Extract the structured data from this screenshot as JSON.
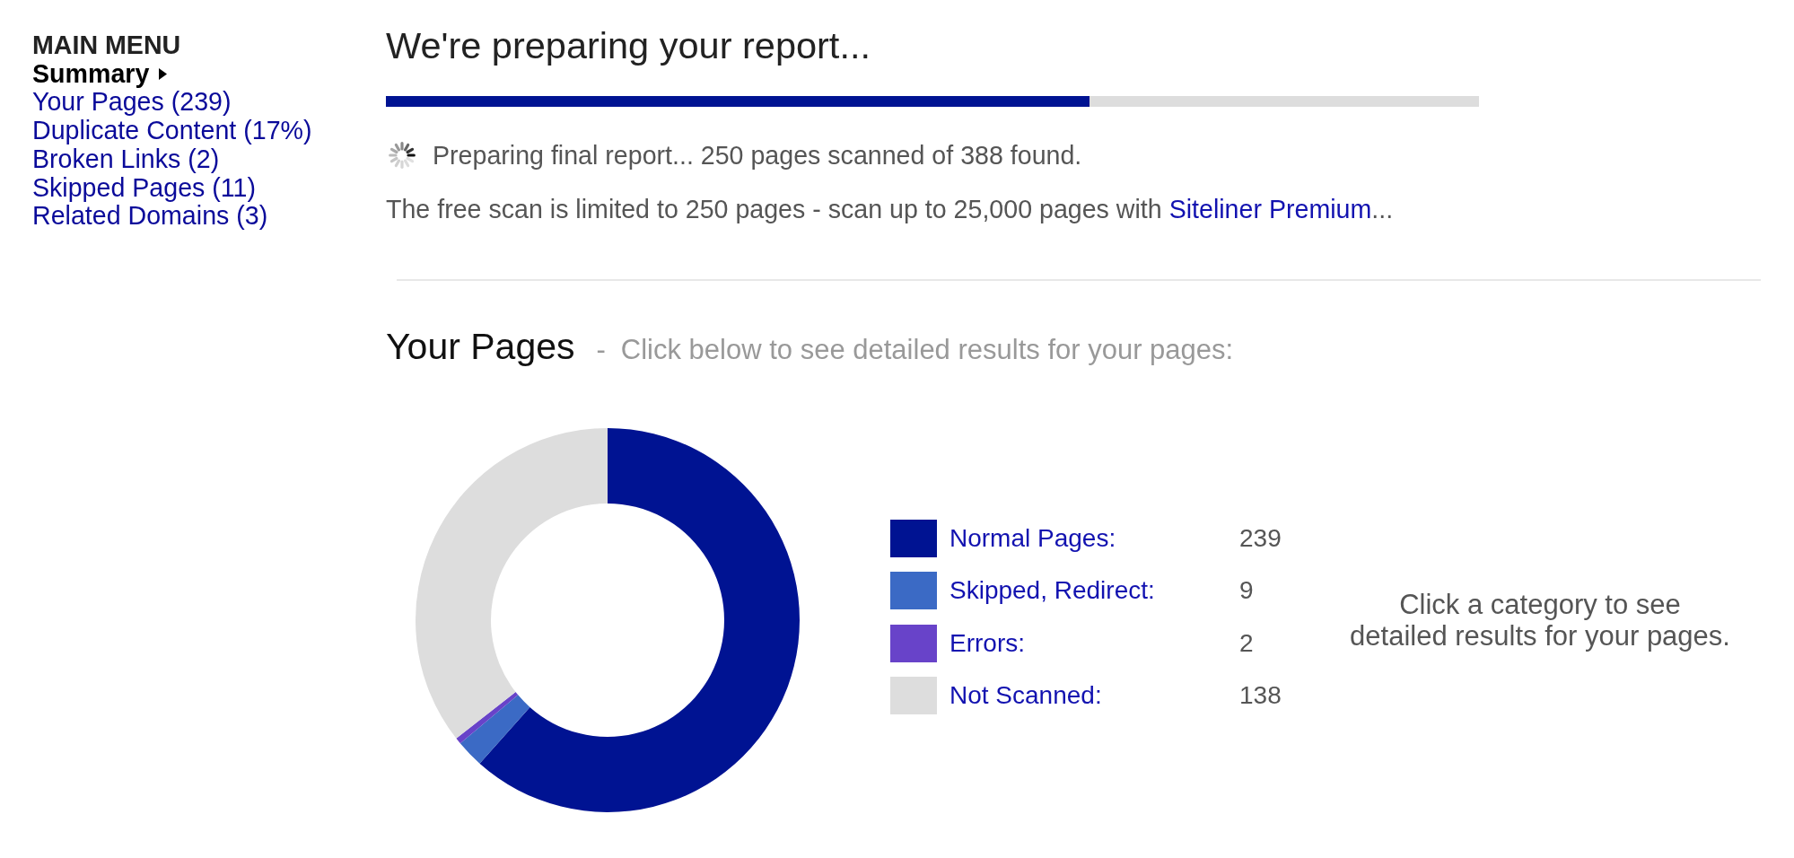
{
  "sidebar": {
    "heading": "MAIN MENU",
    "items": [
      {
        "label": "Summary",
        "selected": true
      },
      {
        "label": "Your Pages (239)",
        "selected": false
      },
      {
        "label": "Duplicate Content (17%)",
        "selected": false
      },
      {
        "label": "Broken Links (2)",
        "selected": false
      },
      {
        "label": "Skipped Pages (11)",
        "selected": false
      },
      {
        "label": "Related Domains (3)",
        "selected": false
      }
    ]
  },
  "report": {
    "title": "We're preparing your report...",
    "progress": {
      "level": 0.644
    },
    "status": "Preparing final report... 250 pages scanned of 388 found.",
    "notice": {
      "text": "The free scan is limited to 250 pages - scan up to 25,000 pages with",
      "link": "Siteliner Premium",
      "suffix": "..."
    }
  },
  "your_pages": {
    "title": "Your Pages",
    "separator": "-",
    "subtitle": "Click below to see detailed results for your pages:",
    "chart_data": {
      "type": "donut",
      "values": [
        61.6,
        2.32,
        0.52,
        35.56
      ]
    },
    "legend": [
      {
        "label": "Normal Pages:",
        "count": "239",
        "color": "#001392"
      },
      {
        "label": "Skipped, Redirect:",
        "count": "9",
        "color": "#3b6ac5"
      },
      {
        "label": "Errors:",
        "count": "2",
        "color": "#6843c9"
      },
      {
        "label": "Not Scanned:",
        "count": "138",
        "color": "#dddddd"
      }
    ],
    "hint": "Click a category to see\ndetailed results for your pages."
  }
}
